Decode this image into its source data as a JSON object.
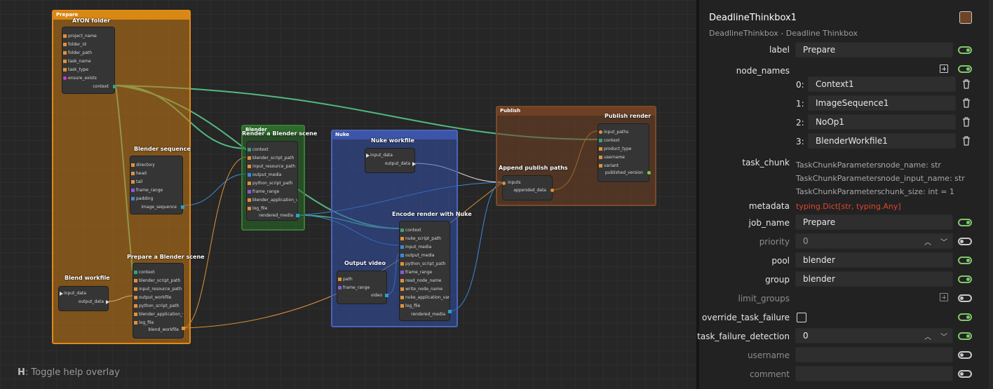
{
  "graph": {
    "backdrops": {
      "prepare": "Prepare",
      "blender": "Blender",
      "nuke": "Nuke",
      "publish": "Publish"
    },
    "nodes": {
      "ayon_folder": {
        "title": "AYON folder",
        "inputs": [
          "project_name",
          "folder_id",
          "folder_path",
          "task_name",
          "task_type",
          "ensure_exists"
        ],
        "output": "context"
      },
      "blender_sequence": {
        "title": "Blender sequence",
        "inputs": [
          "directory",
          "head",
          "tail",
          "frame_range",
          "padding"
        ],
        "output": "image_sequence"
      },
      "blend_workfile": {
        "title": "Blend workfile",
        "input": "input_data",
        "output": "output_data"
      },
      "prepare_blender_scene": {
        "title": "Prepare a Blender scene",
        "inputs": [
          "context",
          "blender_script_path",
          "input_resource_path",
          "output_workfile",
          "python_script_path",
          "blender_application_v",
          "log_file"
        ],
        "output": "blend_workfile"
      },
      "render_blender_scene": {
        "title": "Render a Blender scene",
        "inputs": [
          "context",
          "blender_script_path",
          "input_resource_path",
          "output_media",
          "python_script_path",
          "frame_range",
          "blender_application_v",
          "log_file"
        ],
        "output": "rendered_media"
      },
      "nuke_workfile": {
        "title": "Nuke workfile",
        "input": "input_data",
        "output": "output_data"
      },
      "output_video": {
        "title": "Output video",
        "inputs": [
          "path",
          "frame_range"
        ],
        "output": "video"
      },
      "encode_render_nuke": {
        "title": "Encode render with Nuke",
        "inputs": [
          "context",
          "nuke_script_path",
          "input_media",
          "output_media",
          "python_script_path",
          "frame_range",
          "read_node_name",
          "write_node_name",
          "nuke_application_vari",
          "log_file"
        ],
        "output": "rendered_media"
      },
      "append_publish_paths": {
        "title": "Append publish paths",
        "input": "inputs",
        "output": "appended_data"
      },
      "publish_render": {
        "title": "Publish render",
        "inputs": [
          "input_paths",
          "context",
          "product_type",
          "username",
          "variant"
        ],
        "output": "published_version"
      }
    },
    "help": {
      "key": "H",
      "text": ": Toggle help overlay"
    }
  },
  "panel": {
    "title": "DeadlineThinkbox1",
    "subtitle": "DeadlineThinkbox - Deadline Thinkbox",
    "swatch_color": "#6e4426",
    "fields": {
      "label": {
        "label": "label",
        "value": "Prepare"
      },
      "node_names": {
        "label": "node_names",
        "items": [
          {
            "index": "0:",
            "value": "Context1"
          },
          {
            "index": "1:",
            "value": "ImageSequence1"
          },
          {
            "index": "2:",
            "value": "NoOp1"
          },
          {
            "index": "3:",
            "value": "BlenderWorkfile1"
          }
        ]
      },
      "task_chunk": {
        "label": "task_chunk",
        "rows": [
          {
            "type": "TaskChunkParameters",
            "param": "node_name: str"
          },
          {
            "type": "TaskChunkParameters",
            "param": "node_input_name: str"
          },
          {
            "type": "TaskChunkParameters",
            "param": "chunk_size: int = 1"
          }
        ]
      },
      "metadata": {
        "label": "metadata",
        "value": "typing.Dict[str, typing.Any]"
      },
      "job_name": {
        "label": "job_name",
        "value": "Prepare"
      },
      "priority": {
        "label": "priority",
        "value": "0"
      },
      "pool": {
        "label": "pool",
        "value": "blender"
      },
      "group": {
        "label": "group",
        "value": "blender"
      },
      "limit_groups": {
        "label": "limit_groups"
      },
      "override_task_failure": {
        "label": "override_task_failure"
      },
      "task_failure_detection": {
        "label": "task_failure_detection",
        "value": "0"
      },
      "username": {
        "label": "username",
        "value": ""
      },
      "comment": {
        "label": "comment",
        "value": ""
      }
    },
    "colors": {
      "toggle_on": "#7ec86a",
      "toggle_off": "#c9c9c9",
      "metadata_text": "#e2452c"
    }
  }
}
